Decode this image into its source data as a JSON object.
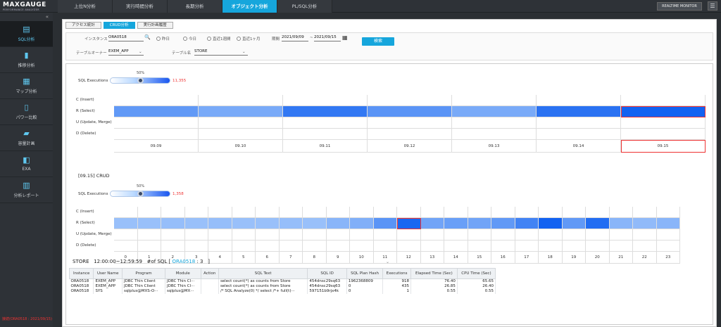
{
  "app": {
    "logo": "MAXGAUGE",
    "tagline": "PERFORMANCE ANALYZER",
    "realtime_btn": "REALTIME MONITOR",
    "footer": "接続(ORA0518 : 2021/09/15)"
  },
  "nav": {
    "tabs": [
      "上位N分析",
      "実行時間分析",
      "長期分析",
      "オブジェクト分析",
      "PL/SQL分析"
    ],
    "active": 3
  },
  "sidebar": {
    "items": [
      {
        "label": "SQL分析",
        "icon": "sql-analysis-icon",
        "active": true
      },
      {
        "label": "推移分析",
        "icon": "bar-chart-icon"
      },
      {
        "label": "マップ分析",
        "icon": "map-icon"
      },
      {
        "label": "パワー比較",
        "icon": "power-compare-icon"
      },
      {
        "label": "容量計画",
        "icon": "capacity-icon"
      },
      {
        "label": "EXA",
        "icon": "exa-icon"
      },
      {
        "label": "分析レポート",
        "icon": "report-icon"
      }
    ]
  },
  "subtabs": {
    "items": [
      "アクセス統計",
      "CRUD分析",
      "実行計画履歴"
    ],
    "active": 1
  },
  "filters": {
    "instance_label": "インスタンス",
    "instance_value": "ORA0518",
    "table_owner_label": "テーブルオーナー",
    "table_owner_value": "EXEM_APP",
    "table_name_label": "テーブル名",
    "table_name_value": "STORE",
    "radios": [
      "昨日",
      "今日",
      "直近1週間",
      "直近1ヶ月"
    ],
    "period_label": "期間",
    "date_from": "2021/09/09",
    "date_to": "2021/09/15",
    "date_sep": "~",
    "search_label": "検索"
  },
  "top_chart": {
    "slider_label": "SQL Executions",
    "slider_pct": "50%",
    "count": "11,355",
    "rows": [
      "C (Insert)",
      "R (Select)",
      "U (Update, Merge)",
      "D (Delete)"
    ],
    "days": [
      "09.09",
      "09.10",
      "09.11",
      "09.12",
      "09.13",
      "09.14",
      "09.15"
    ],
    "select_intensity": [
      0.45,
      0.3,
      0.75,
      0.5,
      0.3,
      0.8,
      0.95
    ],
    "selected_day": "09.15"
  },
  "crud_title": "[09.15] CRUD",
  "bottom_chart": {
    "slider_label": "SQL Executions",
    "slider_pct": "50%",
    "count": "1,358",
    "rows": [
      "C (Insert)",
      "R (Select)",
      "U (Update, Merge)",
      "D (Delete)"
    ],
    "hours": [
      "0",
      "1",
      "2",
      "3",
      "4",
      "5",
      "6",
      "7",
      "8",
      "9",
      "10",
      "11",
      "12",
      "13",
      "14",
      "15",
      "16",
      "17",
      "18",
      "19",
      "20",
      "21",
      "22",
      "23"
    ],
    "select_intensity": [
      0.1,
      0.1,
      0.12,
      0.1,
      0.12,
      0.1,
      0.1,
      0.12,
      0.1,
      0.2,
      0.25,
      0.5,
      0.9,
      0.35,
      0.4,
      0.35,
      0.45,
      0.65,
      0.95,
      0.45,
      0.85,
      0.2,
      0.15,
      0.2
    ],
    "selected_hour": "12"
  },
  "info": {
    "table": "STORE",
    "time": "12:00:00~12:59:59",
    "sql_label": "#of SQL [",
    "instance": "ORA0518",
    "count": ": 3",
    "close": "]"
  },
  "table": {
    "headers": [
      "Instance",
      "User Name",
      "Program",
      "Module",
      "Action",
      "SQL Text",
      "SQL ID",
      "SQL Plan Hash",
      "Executions",
      "Elapsed Time (Sec)",
      "CPU Time (Sec)"
    ],
    "rows": [
      [
        "ORA0518",
        "EXEM_APP",
        "JDBC Thin Client",
        "JDBC Thin Cl···",
        "",
        "select count(*) as counts from Store",
        "454dnsc29sq63",
        "1962368809",
        "918",
        "76.40",
        "65.65"
      ],
      [
        "ORA0518",
        "EXEM_APP",
        "JDBC Thin Client",
        "JDBC Thin Cl···",
        "",
        "select count(*) as counts from Store",
        "454dnsc29sq63",
        "0",
        "435",
        "26.85",
        "26.40"
      ],
      [
        "ORA0518",
        "SYS",
        "sqlplus@MXS-O···",
        "sqlplus@MX···",
        "",
        "/* SQL Analyze(0) */ select /*+ full(t)···",
        "597151b9rjx4k",
        "0",
        "1",
        "0.55",
        "0.55"
      ]
    ]
  },
  "colors": {
    "accent": "#16a6dc",
    "select_dark": "#0a5cf0",
    "select_light": "#a9cbfb"
  }
}
